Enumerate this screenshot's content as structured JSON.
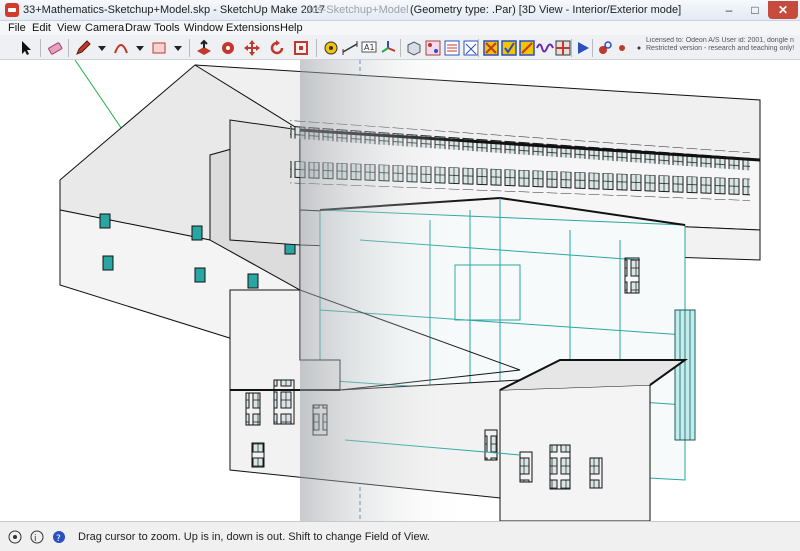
{
  "window": {
    "title": "33+Mathematics-Sketchup+Model.skp - SketchUp Make 2017",
    "title_ghost": "...ics-Sketchup+Model",
    "geometry_info": "(Geometry type: .Par)  [3D View - Interior/Exterior mode]",
    "controls": {
      "minimize": "–",
      "maximize": "□",
      "close": "✕"
    }
  },
  "menu": [
    "File",
    "Edit",
    "View",
    "Camera",
    "Draw",
    "Tools",
    "Window",
    "Extensions",
    "Help"
  ],
  "license_lines": [
    "Licensed to: Odeon A/S   User id: 2001, dongle n",
    "Restricted version - research and teaching only!"
  ],
  "toolbar_icons": [
    "select-icon",
    "eraser-icon",
    "pencil-icon",
    "arc-icon",
    "push-pull-icon",
    "move-icon",
    "rotate-icon",
    "tape-measure-icon",
    "text-icon",
    "axes-icon",
    "component-icon",
    "materials-icon",
    "layers-icon",
    "odeon-tools-icon",
    "play-icon",
    "source-icon",
    "receiver-icon"
  ],
  "status": {
    "message": "Drag cursor to zoom.  Up is in, down is out. Shift to change Field of View."
  },
  "colors": {
    "accent_red": "#d23a2a",
    "wire_teal": "#2aa6a2",
    "model_fill": "#f3f3f3",
    "axis_green": "#23b04a"
  }
}
